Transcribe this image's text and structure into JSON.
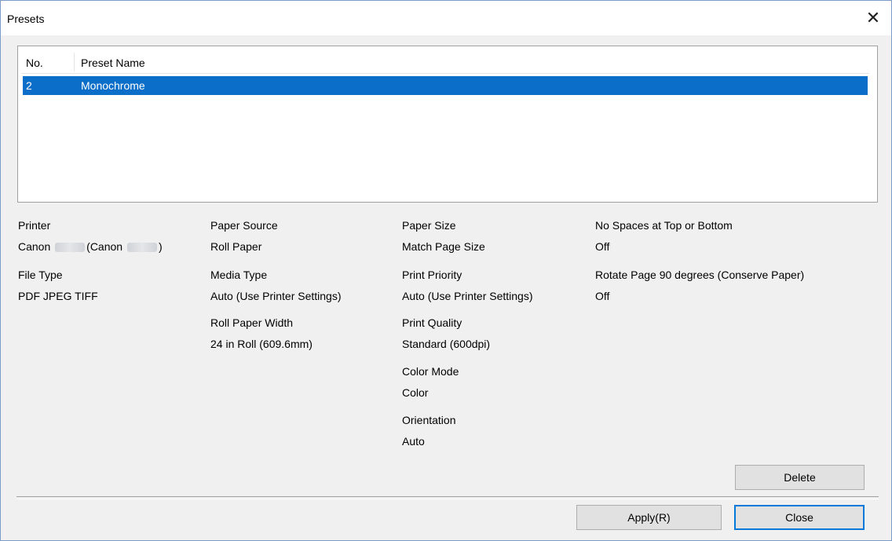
{
  "window": {
    "title": "Presets"
  },
  "list": {
    "headers": {
      "no": "No.",
      "name": "Preset Name"
    },
    "rows": [
      {
        "no": "2",
        "name": "Monochrome",
        "selected": true
      }
    ]
  },
  "details": {
    "printer": {
      "label": "Printer",
      "value_prefix": "Canon",
      "value_middle": "(Canon",
      "value_suffix": ")"
    },
    "file_type": {
      "label": "File Type",
      "value": "PDF JPEG TIFF"
    },
    "paper_source": {
      "label": "Paper Source",
      "value": "Roll Paper"
    },
    "media_type": {
      "label": "Media Type",
      "value": "Auto (Use Printer Settings)"
    },
    "roll_paper_width": {
      "label": "Roll Paper Width",
      "value": "24 in Roll (609.6mm)"
    },
    "paper_size": {
      "label": "Paper Size",
      "value": "Match Page Size"
    },
    "print_priority": {
      "label": "Print Priority",
      "value": "Auto (Use Printer Settings)"
    },
    "print_quality": {
      "label": "Print Quality",
      "value": "Standard (600dpi)"
    },
    "color_mode": {
      "label": "Color Mode",
      "value": "Color"
    },
    "orientation": {
      "label": "Orientation",
      "value": "Auto"
    },
    "no_spaces": {
      "label": "No Spaces at Top or Bottom",
      "value": "Off"
    },
    "rotate_page": {
      "label": "Rotate Page 90 degrees (Conserve Paper)",
      "value": "Off"
    }
  },
  "buttons": {
    "delete": "Delete",
    "apply": "Apply(R)",
    "close": "Close"
  },
  "colors": {
    "selection": "#0b6fc9",
    "default_button_border": "#0078d7",
    "window_bg": "#f0f0f0"
  },
  "icons": {
    "close": "close-icon"
  }
}
